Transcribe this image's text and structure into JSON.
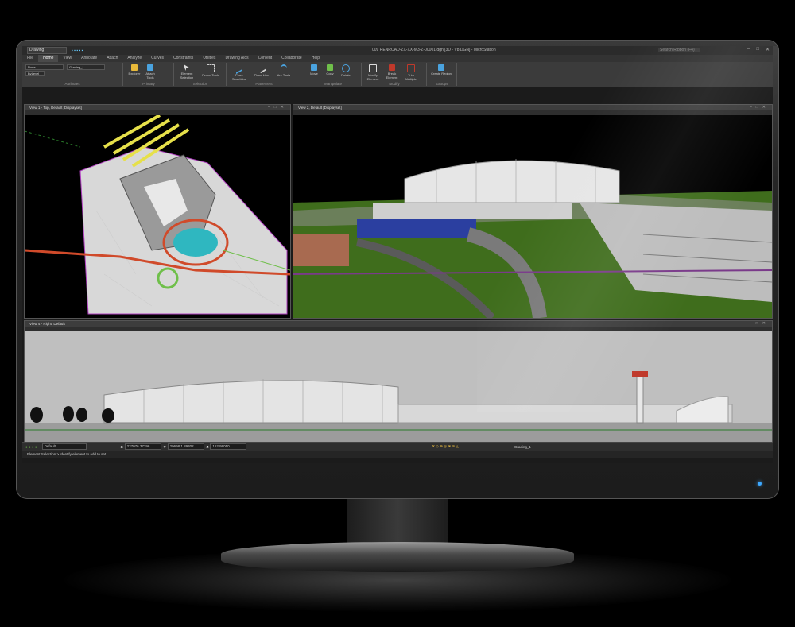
{
  "app": {
    "workflow": "Drawing",
    "window_title": "009 RENROAD-ZX-XX-M3-Z-00001.dgn [3D - V8 DGN] - MicroStation",
    "search_placeholder": "Search Ribbon (F4)"
  },
  "tabs": [
    "File",
    "Home",
    "View",
    "Annotate",
    "Attach",
    "Analyze",
    "Curves",
    "Constraints",
    "Utilities",
    "Drawing Aids",
    "Content",
    "Collaborate",
    "Help"
  ],
  "active_tab": "Home",
  "attributes": {
    "level": "None",
    "template": "Grading_1",
    "weight": "ByLevel"
  },
  "ribbon_groups": [
    {
      "label": "Attributes",
      "buttons": []
    },
    {
      "label": "Primary",
      "buttons": [
        "Explorer",
        "Attach Tools"
      ]
    },
    {
      "label": "Selection",
      "buttons": [
        "Element Selection",
        "Fence Tools"
      ]
    },
    {
      "label": "Placement",
      "buttons": [
        "Place SmartLine",
        "Place Line",
        "Arc Tools"
      ]
    },
    {
      "label": "Manipulate",
      "buttons": [
        "Move",
        "Copy",
        "Rotate"
      ]
    },
    {
      "label": "Modify",
      "buttons": [
        "Modify Element",
        "Break Element",
        "Trim Multiple"
      ]
    },
    {
      "label": "Groups",
      "buttons": [
        "Create Region"
      ]
    }
  ],
  "views": {
    "view1": "View 1 - Top, Default [Displayset]",
    "view2": "View 2, Default [Displayset]",
    "view4": "View 4 - Right, Default"
  },
  "status": {
    "view_style": "Default",
    "x_label": "X",
    "x_value": "237076.37296",
    "y_label": "Y",
    "y_value": "29698.1.89302",
    "z_label": "Z",
    "z_value": "162.99050",
    "active_level": "Grading_1"
  },
  "prompt": "Element Selection > Identify element to add to set",
  "colors": {
    "accent": "#3da8ff",
    "grass": "#3f6d1c",
    "road": "#c0392b",
    "sky": "#bfbfbf"
  }
}
